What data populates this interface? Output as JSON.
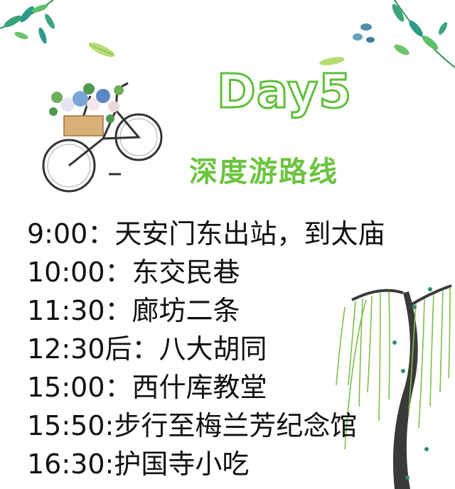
{
  "title": "Day5",
  "subtitle": "深度游路线",
  "schedule": [
    {
      "time": "9:00：",
      "place": "天安门东出站，到太庙"
    },
    {
      "time": "10:00：",
      "place": "东交民巷"
    },
    {
      "time": "11:30：",
      "place": "廊坊二条"
    },
    {
      "time": "12:30后：",
      "place": "八大胡同"
    },
    {
      "time": "15:00：",
      "place": "西什库教堂"
    },
    {
      "time": "15:50:",
      "place": "步行至梅兰芳纪念馆"
    },
    {
      "time": "16:30:",
      "place": "护国寺小吃"
    }
  ],
  "colors": {
    "accent_green": "#5fbf3a",
    "text": "#111111"
  },
  "decorations": [
    "leaf-branch-icon",
    "bicycle-flower-basket-illustration",
    "willow-tree-illustration"
  ]
}
